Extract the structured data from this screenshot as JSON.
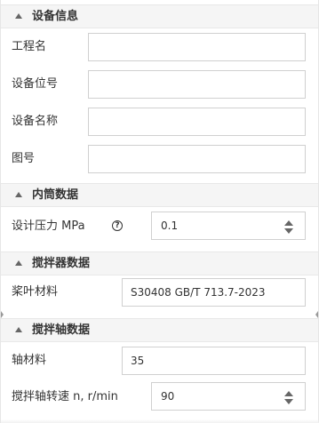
{
  "sections": {
    "equipment_info": {
      "title": "设备信息",
      "fields": {
        "project_name": {
          "label": "工程名",
          "value": ""
        },
        "equipment_tag": {
          "label": "设备位号",
          "value": ""
        },
        "equipment_name": {
          "label": "设备名称",
          "value": ""
        },
        "drawing_number": {
          "label": "图号",
          "value": ""
        }
      }
    },
    "inner_vessel": {
      "title": "内筒数据",
      "fields": {
        "design_pressure": {
          "label": "设计压力 MPa",
          "value": "0.1"
        }
      }
    },
    "agitator": {
      "title": "搅拌器数据",
      "fields": {
        "blade_material": {
          "label": "桨叶材料",
          "value": "S30408 GB/T 713.7-2023"
        }
      }
    },
    "agitator_shaft": {
      "title": "搅拌轴数据",
      "fields": {
        "shaft_material": {
          "label": "轴材料",
          "value": "35"
        },
        "shaft_speed": {
          "label": "搅拌轴转速 n, r/min",
          "value": "90"
        }
      }
    }
  },
  "icons": {
    "collapse": "triangle-up-icon",
    "help": "question-circle-icon",
    "spinner_up": "spinner-up-icon",
    "spinner_down": "spinner-down-icon"
  }
}
